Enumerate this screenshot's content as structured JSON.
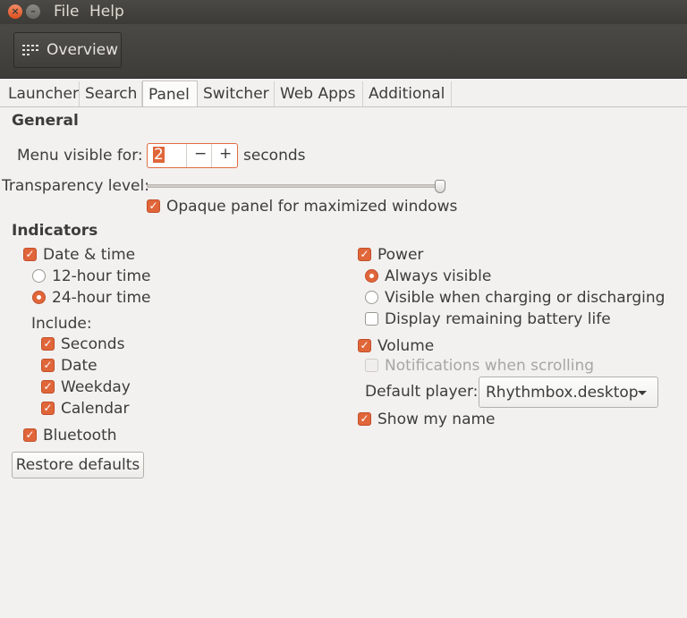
{
  "titlebar": {
    "close_symbol": "×",
    "minimize_symbol": "–",
    "menu": [
      "File",
      "Help"
    ]
  },
  "toolbar": {
    "overview_label": "Overview"
  },
  "tabs": [
    "Launcher",
    "Search",
    "Panel",
    "Switcher",
    "Web Apps",
    "Additional"
  ],
  "active_tab": "Panel",
  "general": {
    "heading": "General",
    "menu_visible_label": "Menu visible for:",
    "menu_visible_value": "2",
    "minus": "−",
    "plus": "+",
    "seconds_unit": "seconds",
    "transparency_label": "Transparency level:",
    "transparency_value": 1.0,
    "opaque_label": "Opaque panel for maximized windows",
    "opaque_checked": true
  },
  "indicators": {
    "heading": "Indicators",
    "date_time": "Date & time",
    "twelve_hour": "12-hour time",
    "twenty_four_hour": "24-hour time",
    "include_label": "Include:",
    "seconds": "Seconds",
    "date": "Date",
    "weekday": "Weekday",
    "calendar": "Calendar",
    "bluetooth": "Bluetooth",
    "power": "Power",
    "always_visible": "Always visible",
    "visible_charging": "Visible when charging or discharging",
    "display_battery": "Display remaining battery life",
    "volume": "Volume",
    "notifications_scrolling": "Notifications when scrolling",
    "default_player_label": "Default player:",
    "default_player_value": "Rhythmbox.desktop",
    "show_name": "Show my name"
  },
  "restore_defaults": "Restore defaults",
  "check_mark": "✓",
  "colors": {
    "accent": "#e0663a",
    "titlebar": "#3c3b37",
    "background": "#f2f1f0"
  }
}
